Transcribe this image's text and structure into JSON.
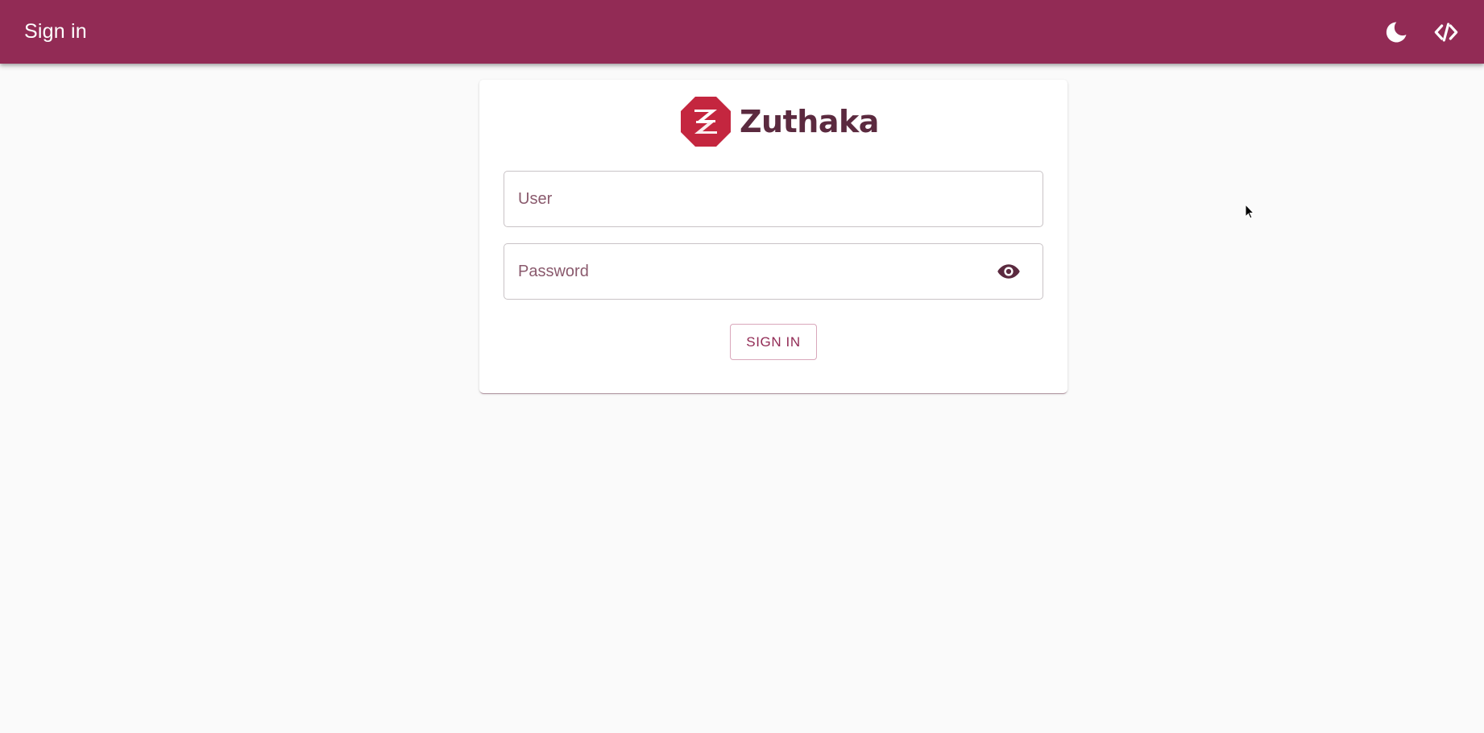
{
  "appbar": {
    "title": "Sign in",
    "background": "#922b55",
    "actions": [
      {
        "icon": "moon-icon",
        "label": "Toggle dark mode"
      },
      {
        "icon": "code-icon",
        "label": "Source code"
      }
    ]
  },
  "logo": {
    "text": "Zuthaka",
    "mark_color": "#c4263f",
    "text_color": "#5b2a3f"
  },
  "form": {
    "user": {
      "placeholder": "User",
      "value": ""
    },
    "password": {
      "placeholder": "Password",
      "value": "",
      "toggle_icon": "eye-icon"
    },
    "submit_label": "SIGN IN"
  }
}
